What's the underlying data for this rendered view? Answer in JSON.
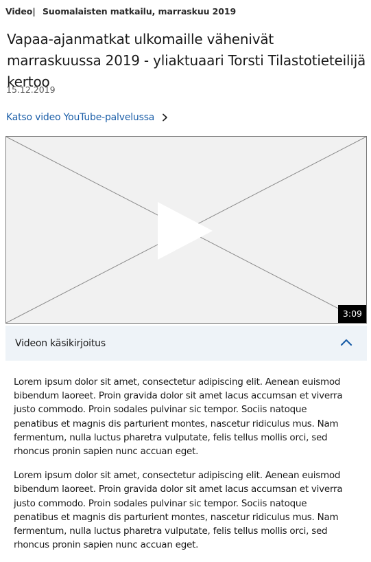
{
  "header": {
    "category": "Video",
    "separator": "|",
    "series": "Suomalaisten matkailu, marraskuu 2019"
  },
  "article": {
    "title": "Vapaa-ajanmatkat ulkomaille vähenivät marraskuussa 2019 - yliaktuaari Torsti Tilastotieteilijä kertoo",
    "date": "15.12.2019"
  },
  "youtube_link": {
    "label": "Katso video YouTube-palvelussa",
    "icon": "chevron-right-icon"
  },
  "video": {
    "duration": "3:09",
    "icon": "play-icon"
  },
  "transcript": {
    "toggle_label": "Videon käsikirjoitus",
    "toggle_icon": "chevron-up-icon",
    "expanded": true,
    "paragraphs": [
      "Lorem ipsum dolor sit amet, consectetur adipiscing elit. Aenean euismod bibendum laoreet. Proin gravida dolor sit amet lacus accumsan et viverra justo commodo. Proin sodales pulvinar sic tempor. Sociis natoque penatibus et magnis dis parturient montes, nascetur ridiculus mus. Nam fermentum, nulla luctus pharetra vulputate, felis tellus mollis orci, sed rhoncus pronin sapien nunc accuan eget.",
      "Lorem ipsum dolor sit amet, consectetur adipiscing elit. Aenean euismod bibendum laoreet. Proin gravida dolor sit amet lacus accumsan et viverra justo commodo. Proin sodales pulvinar sic tempor. Sociis natoque penatibus et magnis dis parturient montes, nascetur ridiculus mus. Nam fermentum, nulla luctus pharetra vulputate, felis tellus mollis orci, sed rhoncus pronin sapien nunc accuan eget."
    ]
  },
  "colors": {
    "link": "#1b5ea8",
    "accordion_bg": "#eef3f8",
    "chevron": "#1b5ea8"
  }
}
